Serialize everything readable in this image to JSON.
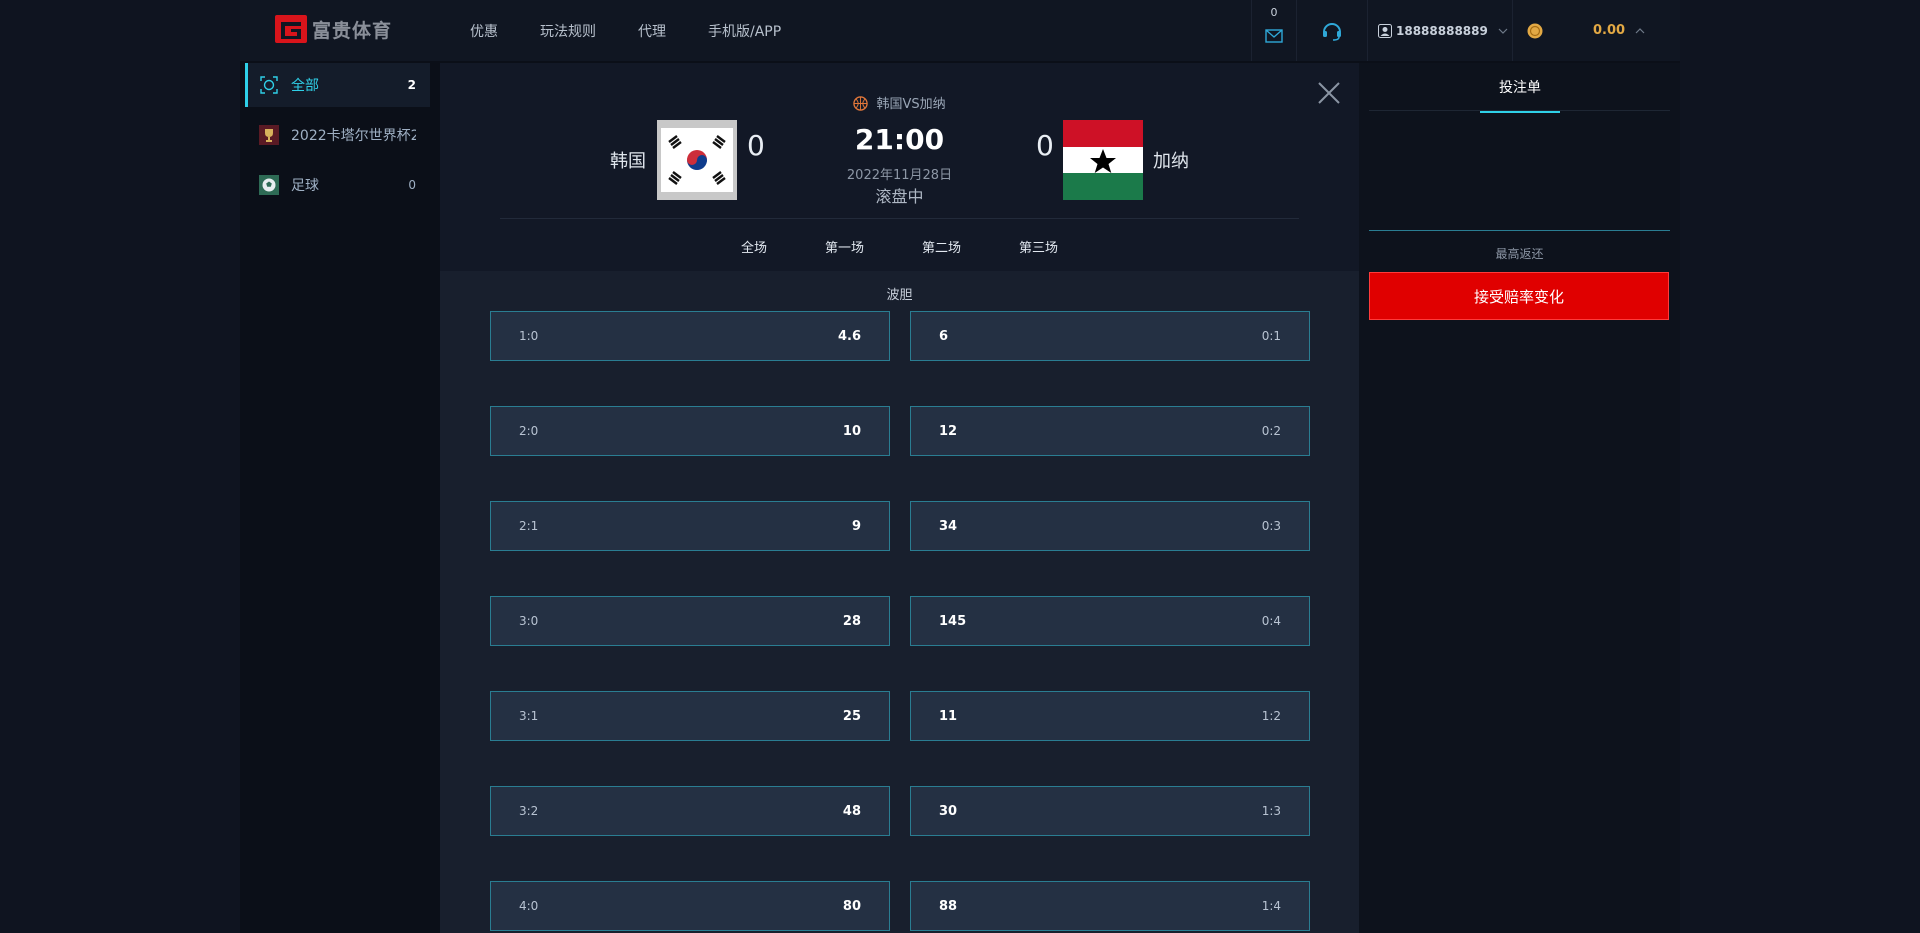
{
  "header": {
    "logo_text": "富贵体育",
    "nav": [
      "优惠",
      "玩法规则",
      "代理",
      "手机版/APP"
    ],
    "mail_count": "0",
    "username": "18888888889",
    "balance": "0.00"
  },
  "sidebar": {
    "items": [
      {
        "label": "全部",
        "count": "2"
      },
      {
        "label": "2022卡塔尔世界杯2",
        "count": ""
      },
      {
        "label": "足球",
        "count": "0"
      }
    ]
  },
  "match": {
    "title": "韩国VS加纳",
    "home": {
      "name": "韩国",
      "score": "0"
    },
    "away": {
      "name": "加纳",
      "score": "0"
    },
    "time": "21:00",
    "date": "2022年11月28日",
    "status": "滚盘中",
    "periods": [
      "全场",
      "第一场",
      "第二场",
      "第三场"
    ]
  },
  "market": {
    "title": "波胆",
    "rows": [
      {
        "left_score": "1:0",
        "left_odds": "4.6",
        "right_odds": "6",
        "right_score": "0:1"
      },
      {
        "left_score": "2:0",
        "left_odds": "10",
        "right_odds": "12",
        "right_score": "0:2"
      },
      {
        "left_score": "2:1",
        "left_odds": "9",
        "right_odds": "34",
        "right_score": "0:3"
      },
      {
        "left_score": "3:0",
        "left_odds": "28",
        "right_odds": "145",
        "right_score": "0:4"
      },
      {
        "left_score": "3:1",
        "left_odds": "25",
        "right_odds": "11",
        "right_score": "1:2"
      },
      {
        "left_score": "3:2",
        "left_odds": "48",
        "right_odds": "30",
        "right_score": "1:3"
      },
      {
        "left_score": "4:0",
        "left_odds": "80",
        "right_odds": "88",
        "right_score": "1:4"
      }
    ]
  },
  "betslip": {
    "tab": "投注单",
    "max_return_label": "最高返还",
    "accept_button": "接受赔率变化"
  },
  "colors": {
    "accent": "#2fd0e8",
    "odds_border": "#2a7d92",
    "balance": "#e3a944",
    "accept_button": "#e00000"
  }
}
